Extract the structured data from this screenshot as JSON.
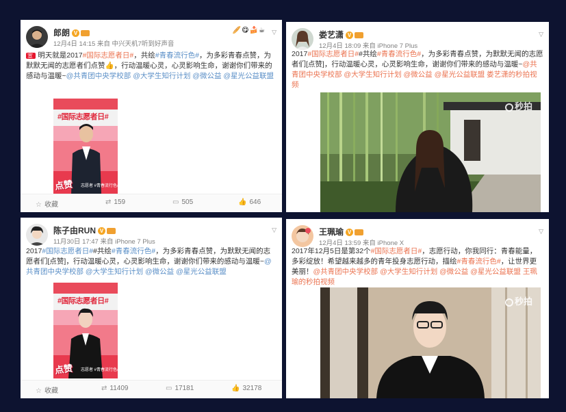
{
  "posts": [
    {
      "name": "郎朗",
      "meta": "12月4日 14:15 来自 中兴天机7听到好声音",
      "text_parts": [
        {
          "t": "宣 ",
          "c": "badge"
        },
        {
          "t": "明天就是2017",
          "c": ""
        },
        {
          "t": "#国际志愿者日#",
          "c": "tag"
        },
        {
          "t": "，共绘",
          "c": ""
        },
        {
          "t": "#青春流行色#",
          "c": "blue"
        },
        {
          "t": "，为多彩青春点赞，为默默无闻的志愿者们点赞👍，行动温暖心灵，心灵影响生命，谢谢你们带来的感动与温暖~",
          "c": ""
        },
        {
          "t": "@共青团中央学校部 @大学生知行计划 @微公益 @星光公益联盟",
          "c": "blue"
        }
      ],
      "footer": {
        "collect": "收藏",
        "repost": "159",
        "comment": "505",
        "like": "646"
      }
    },
    {
      "name": "娄艺潇",
      "meta": "12月4日 18:09 来自 iPhone 7 Plus",
      "text_parts": [
        {
          "t": "2017",
          "c": ""
        },
        {
          "t": "#国际志愿者日#",
          "c": "tag"
        },
        {
          "t": "#共绘",
          "c": ""
        },
        {
          "t": "#青春流行色#",
          "c": "tag"
        },
        {
          "t": "，为多彩青春点赞，为默默无闻的志愿者们[点赞]，行动温暖心灵，心灵影响生命，谢谢你们带来的感动与温暖~",
          "c": ""
        },
        {
          "t": "@共青团中央学校部 @大学生知行计划 @微公益 @星光公益联盟 ",
          "c": "link"
        },
        {
          "t": "娄艺潇的秒拍视频",
          "c": "link"
        }
      ],
      "watermark": "秒拍"
    },
    {
      "name": "陈子由RUN",
      "meta": "11月30日 17:47 来自 iPhone 7 Plus",
      "text_parts": [
        {
          "t": "2017",
          "c": ""
        },
        {
          "t": "#国际志愿者日#",
          "c": "blue"
        },
        {
          "t": "#共绘",
          "c": ""
        },
        {
          "t": "#青春流行色#",
          "c": "blue"
        },
        {
          "t": "，为多彩青春点赞，为默默无闻的志愿者们[点赞]，行动温暖心灵，心灵影响生命，谢谢你们带来的感动与温暖~",
          "c": ""
        },
        {
          "t": "@共青团中央学校部 @大学生知行计划 @微公益 @星光公益联盟",
          "c": "blue"
        }
      ],
      "footer": {
        "collect": "收藏",
        "repost": "11409",
        "comment": "17181",
        "like": "32178"
      }
    },
    {
      "name": "王珮瑜",
      "meta": "12月4日 13:59 来自 iPhone X",
      "text_parts": [
        {
          "t": "2017年12月5日是第32个",
          "c": ""
        },
        {
          "t": "#国际志愿者日#",
          "c": "tag"
        },
        {
          "t": "，志愿行动，你我同行：青春能量，多彩绽放！希望越来越多的青年投身志愿行动，描绘",
          "c": ""
        },
        {
          "t": "#青春流行色#",
          "c": "tag"
        },
        {
          "t": "，让世界更美丽！",
          "c": ""
        },
        {
          "t": "@共青团中央学校部 @大学生知行计划 @微公益 @星光公益联盟 ",
          "c": "link"
        },
        {
          "t": "王珮瑜的秒拍视频",
          "c": "link"
        }
      ],
      "watermark": "秒拍"
    }
  ],
  "poster": {
    "title": "#国际志愿者日#",
    "slogan": "点赞",
    "sub": "志愿者 #青春流行色#"
  },
  "colors": {
    "background": "#0d1330",
    "accent": "#eb7350",
    "link": "#5b8fc7"
  }
}
